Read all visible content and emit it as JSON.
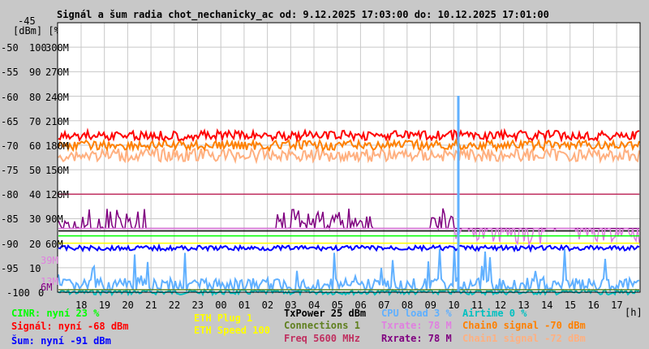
{
  "title": "Signál a šum radia chot_nechanicky_ac od: 9.12.2025 17:03:00 do: 10.12.2025 17:01:00",
  "chart_data": {
    "type": "line",
    "title": "Signál a šum radia chot_nechanicky_ac od: 9.12.2025 17:03:00 do: 10.12.2025 17:01:00",
    "y_unit_labels": "[dBm] [%]",
    "ylim_dbm": [
      -100,
      -45
    ],
    "ylim_percent": [
      0,
      100
    ],
    "ylim_rate": [
      0,
      300
    ],
    "x_unit": "[h]",
    "grid": true,
    "y_ticks": [
      {
        "dbm": "-45",
        "pct": "",
        "rate": ""
      },
      {
        "dbm": "-50",
        "pct": "100",
        "rate": "300M"
      },
      {
        "dbm": "-55",
        "pct": "90",
        "rate": "270M"
      },
      {
        "dbm": "-60",
        "pct": "80",
        "rate": "240M"
      },
      {
        "dbm": "-65",
        "pct": "70",
        "rate": "210M"
      },
      {
        "dbm": "-70",
        "pct": "60",
        "rate": "180M"
      },
      {
        "dbm": "-75",
        "pct": "50",
        "rate": "150M"
      },
      {
        "dbm": "-80",
        "pct": "40",
        "rate": "120M"
      },
      {
        "dbm": "-85",
        "pct": "30",
        "rate": "90M"
      },
      {
        "dbm": "-90",
        "pct": "20",
        "rate": "60M"
      },
      {
        "dbm": "-95",
        "pct": "10",
        "rate": ""
      },
      {
        "dbm": "-100",
        "pct": "0",
        "rate": ""
      }
    ],
    "extra_rate_labels": [
      {
        "text": "39M",
        "value": 39,
        "color": "#e080e0"
      },
      {
        "text": "13M",
        "value": 13,
        "color": "#e080e0"
      },
      {
        "text": "6M",
        "value": 6,
        "color": "#800080"
      }
    ],
    "x_ticks": [
      "18",
      "19",
      "20",
      "21",
      "22",
      "23",
      "00",
      "01",
      "02",
      "03",
      "04",
      "05",
      "06",
      "07",
      "08",
      "09",
      "10",
      "11",
      "12",
      "13",
      "14",
      "15",
      "16",
      "17"
    ],
    "series": [
      {
        "name": "Signál",
        "color": "#ff0000",
        "level_dbm": -68
      },
      {
        "name": "Chain0 signal",
        "color": "#ff8000",
        "level_dbm": -70
      },
      {
        "name": "Chain1 signal",
        "color": "#ffb080",
        "level_dbm": -72
      },
      {
        "name": "Šum",
        "color": "#0000ff",
        "level_dbm": -91
      },
      {
        "name": "CINR",
        "color": "#00ff00",
        "level_percent": 23
      },
      {
        "name": "Rxrate",
        "color": "#800080",
        "level_rate": 78
      },
      {
        "name": "Txrate",
        "color": "#e080e0",
        "level_rate": 78
      },
      {
        "name": "Freq",
        "color": "#c03060",
        "level_dbm": -80
      },
      {
        "name": "TxPower",
        "color": "#000000",
        "level_dbm": -87.5
      },
      {
        "name": "ETH Speed",
        "color": "#ffff00",
        "level_dbm": -90
      },
      {
        "name": "CPU load",
        "color": "#60b0ff",
        "level_percent": 3
      },
      {
        "name": "Airtime",
        "color": "#00c0c0",
        "level_percent": 0
      },
      {
        "name": "Connections",
        "color": "#608020",
        "level_percent": 1
      }
    ]
  },
  "legend": {
    "cinr": "CINR: nyní 23 %",
    "signal": "Signál: nyní -68 dBm",
    "noise": "Šum: nyní -91 dBm",
    "eth_plug": "ETH Plug 1",
    "eth_speed": "ETH Speed 100",
    "txpower": "TxPower 25 dBm",
    "connections": "Connections 1",
    "freq": "Freq 5600 MHz",
    "cpu": "CPU load 3 %",
    "txrate": "Txrate: 78 M",
    "rxrate": "Rxrate: 78 M",
    "airtime": "Airtime 0 %",
    "chain0": "Chain0 signal -70 dBm",
    "chain1": "Chain1 signal -72 dBm",
    "hour_unit": "[h]"
  }
}
